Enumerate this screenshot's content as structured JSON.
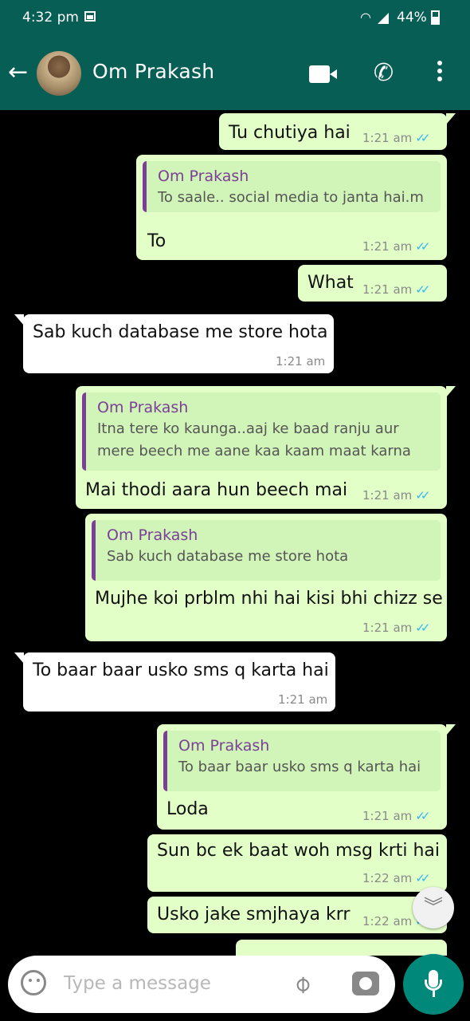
{
  "status_bar": {
    "time": "4:32 pm",
    "battery": "44%"
  },
  "header": {
    "contact_name": "Om Prakash"
  },
  "messages": [
    {
      "dir": "out",
      "text": "Tu chutiya hai",
      "time": "1:21 am"
    },
    {
      "dir": "out",
      "quote_author": "Om Prakash",
      "quote_lines": [
        "To saale.. social media to janta hai.m"
      ],
      "text": "To",
      "time": "1:21 am"
    },
    {
      "dir": "out",
      "text": "What",
      "time": "1:21 am"
    },
    {
      "dir": "in",
      "text": "Sab kuch database me store hota",
      "time": "1:21 am"
    },
    {
      "dir": "out",
      "quote_author": "Om Prakash",
      "quote_lines": [
        "Itna tere ko kaunga..aaj ke baad ranju aur",
        "mere beech me aane kaa kaam maat karna"
      ],
      "text": "Mai thodi aara hun beech mai",
      "time": "1:21 am"
    },
    {
      "dir": "out",
      "quote_author": "Om Prakash",
      "quote_lines": [
        "Sab kuch database me store hota"
      ],
      "text": "Mujhe koi prblm nhi hai kisi bhi chizz se",
      "time": "1:21 am"
    },
    {
      "dir": "in",
      "text": "To baar baar usko sms q karta hai",
      "time": "1:21 am"
    },
    {
      "dir": "out",
      "quote_author": "Om Prakash",
      "quote_lines": [
        "To baar baar usko sms q karta hai"
      ],
      "text": "Loda",
      "time": "1:21 am"
    },
    {
      "dir": "out",
      "text": "Sun bc ek baat woh msg krti hai",
      "time": "1:22 am"
    },
    {
      "dir": "out",
      "text": "Usko jake smjhaya krr",
      "time": "1:22 am"
    }
  ],
  "composer": {
    "placeholder": "Type a message"
  },
  "icons": {
    "back": "arrow-left-icon",
    "video": "video-call-icon",
    "call": "phone-icon",
    "more": "more-vert-icon",
    "emoji": "emoji-icon",
    "attach": "paperclip-icon",
    "camera": "camera-icon",
    "mic": "mic-icon",
    "scroll": "chevron-double-down-icon",
    "read": "double-check-icon"
  },
  "colors": {
    "header": "#075e54",
    "outgoing_bubble": "#e2ffc7",
    "incoming_bubble": "#ffffff",
    "quote_author": "#7b3f98",
    "read_ticks": "#34b7f1",
    "mic_button": "#00897b"
  }
}
